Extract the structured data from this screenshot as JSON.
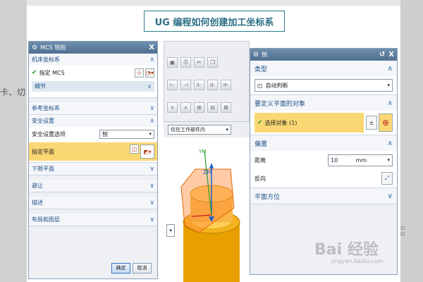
{
  "page_title": "UG 编程如何创建加工坐标系",
  "bg_left_text": "卡、切",
  "mcs_dialog": {
    "title": "MCS 铣削",
    "sections": {
      "machine_cs": {
        "label": "机床坐标系",
        "specify_label": "指定 MCS",
        "details_label": "细节"
      },
      "reference_cs": {
        "label": "参考坐标系"
      },
      "safety": {
        "label": "安全设置",
        "option_label": "安全设置选项",
        "option_value": "刨",
        "specify_plane_label": "指定平面"
      },
      "lower_limit": {
        "label": "下限平面"
      },
      "avoid": {
        "label": "避让"
      },
      "description": {
        "label": "描述"
      },
      "layout_layer": {
        "label": "布局和图层"
      }
    },
    "ok_label": "确定",
    "cancel_label": "取消"
  },
  "filter_select": {
    "value": "仅在工作部件内"
  },
  "viewport": {
    "axis_ym": "YM",
    "axis_zm": "ZM"
  },
  "plane_dialog": {
    "title": "刨",
    "type_section": {
      "label": "类型",
      "value": "自动判断"
    },
    "object_section": {
      "label": "要定义平面的对象",
      "select_label": "选择对象 (1)"
    },
    "offset_section": {
      "label": "偏置",
      "distance_label": "距离",
      "distance_value": "10",
      "distance_unit": "mm",
      "reverse_label": "反向"
    },
    "orientation_section": {
      "label": "平面方位"
    }
  },
  "watermark": {
    "main": "Bai 经验",
    "sub": "jingyan.baidu.com"
  },
  "colors": {
    "accent": "#2b6f86",
    "highlight": "#fbd774",
    "header": "#4f6f91",
    "part": "#e8a000"
  }
}
